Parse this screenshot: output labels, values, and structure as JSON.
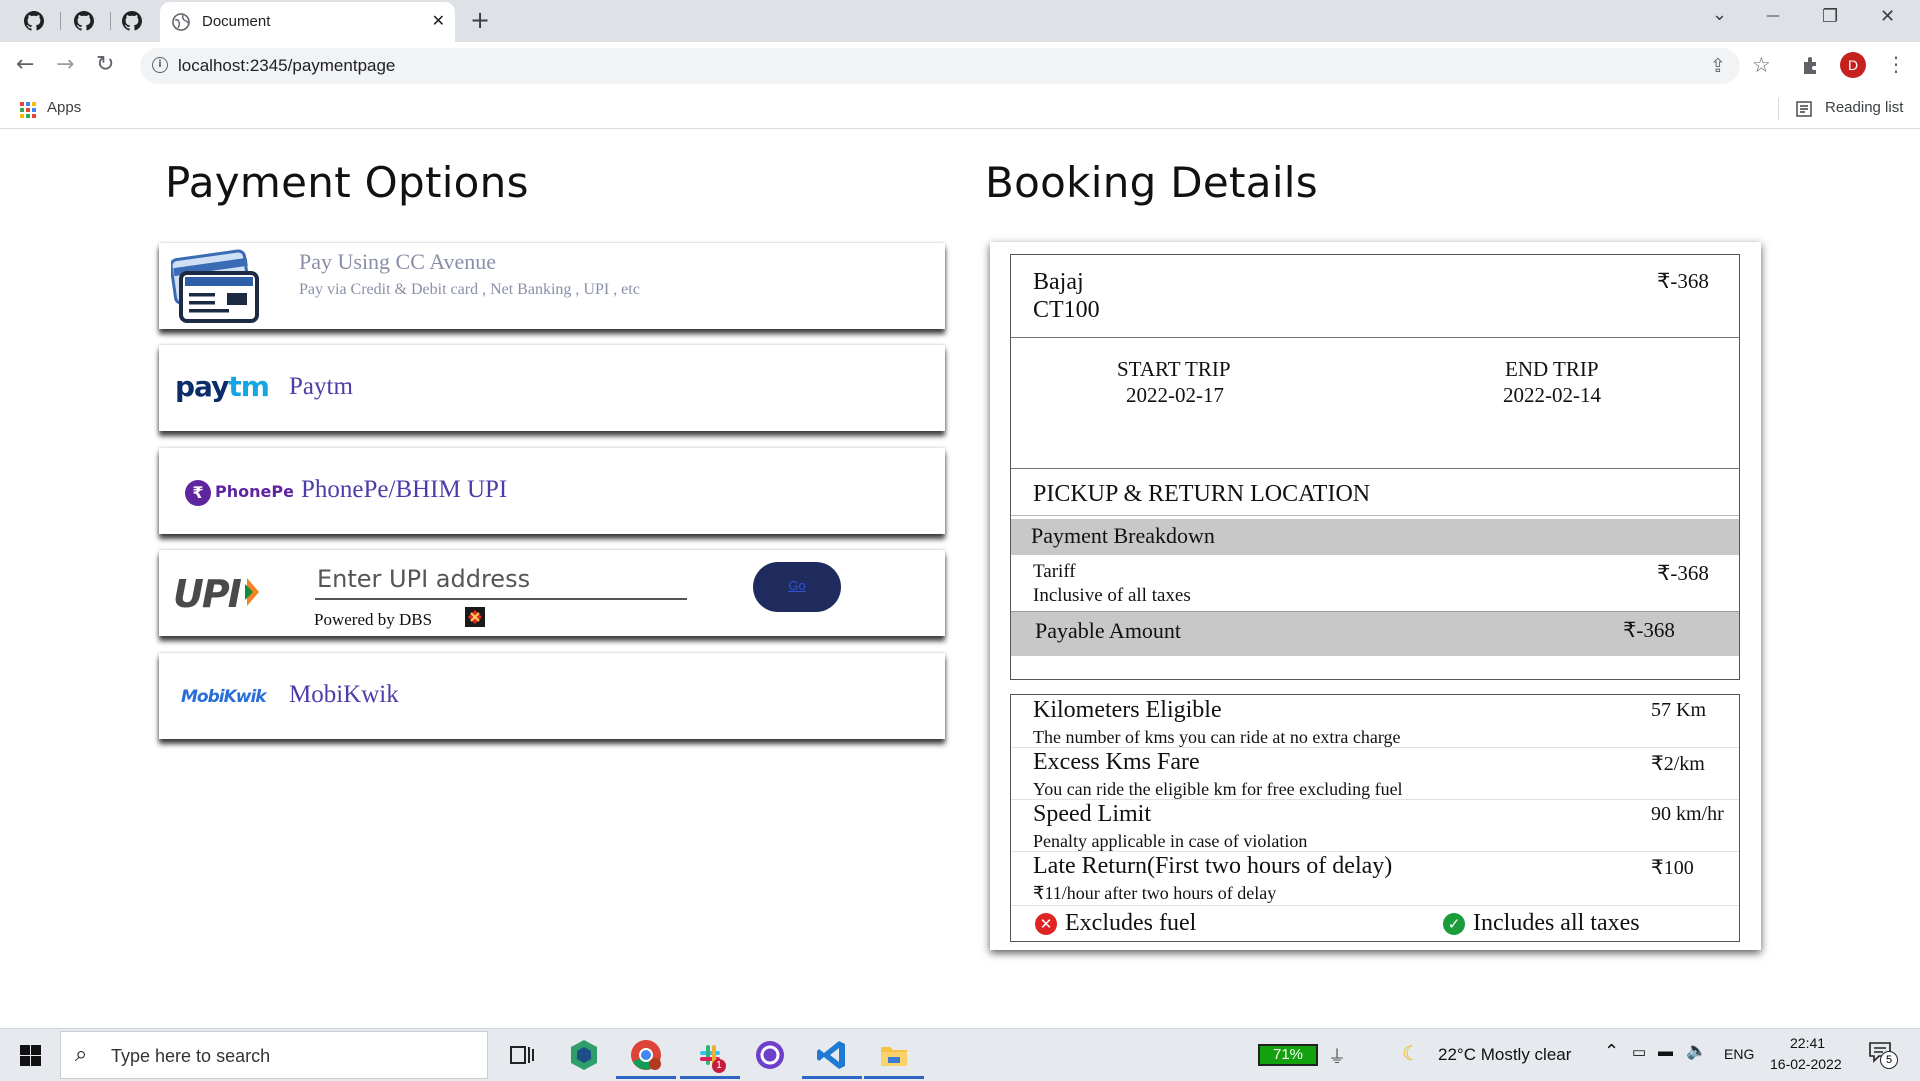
{
  "browser": {
    "tab_title": "Document",
    "tab_close": "✕",
    "new_tab": "+",
    "url": "localhost:2345/paymentpage",
    "avatar_letter": "D",
    "bookmarks_apps": "Apps",
    "reading_list": "Reading list",
    "window_controls": {
      "dropdown": "⌄",
      "minimize": "—",
      "restore": "❐",
      "close": "✕"
    }
  },
  "payment": {
    "heading": "Payment Options",
    "cc_avenue": {
      "title": "Pay Using CC Avenue",
      "subtitle": "Pay via Credit & Debit card , Net Banking , UPI , etc"
    },
    "paytm": {
      "logo_text": "paytm",
      "label": "Paytm"
    },
    "phonepe": {
      "logo_text": "PhonePe",
      "label": "PhonePe/BHIM UPI"
    },
    "upi": {
      "logo_text": "UPI",
      "placeholder": "Enter UPI address",
      "powered_by": "Powered by DBS",
      "go_label": "Go"
    },
    "mobikwik": {
      "logo_text": "MobiKwik",
      "label": "MobiKwik"
    }
  },
  "booking": {
    "heading": "Booking Details",
    "vehicle": {
      "brand": "Bajaj",
      "model": "CT100",
      "price": "₹-368"
    },
    "start_trip": {
      "label": "START TRIP",
      "date": "2022-02-17"
    },
    "end_trip": {
      "label": "END TRIP",
      "date": "2022-02-14"
    },
    "pickup_label": "PICKUP & RETURN LOCATION",
    "breakdown_label": "Payment Breakdown",
    "tariff": {
      "label": "Tariff",
      "note": "Inclusive of all taxes",
      "value": "₹-368"
    },
    "payable": {
      "label": "Payable Amount",
      "value": "₹-368"
    },
    "terms": [
      {
        "title": "Kilometers Eligible",
        "desc": "The number of kms you can ride at no extra charge",
        "value": "57 Km"
      },
      {
        "title": "Excess Kms Fare",
        "desc": "You can ride the eligible km for free excluding fuel",
        "value": "₹2/km"
      },
      {
        "title": "Speed Limit",
        "desc": "Penalty applicable in case of violation",
        "value": "90 km/hr"
      },
      {
        "title": "Late Return(First two hours of delay)",
        "desc": "₹11/hour after two hours of delay",
        "value": "₹100"
      }
    ],
    "excludes_fuel": "Excludes fuel",
    "includes_taxes": "Includes all taxes"
  },
  "taskbar": {
    "search_placeholder": "Type here to search",
    "battery": "71%",
    "weather": "22°C  Mostly clear",
    "language": "ENG",
    "time": "22:41",
    "date": "16-02-2022",
    "notification_count": "5",
    "slack_badge": "1"
  },
  "colors": {
    "accent_purple": "#4b3ea8",
    "go_button": "#1f2b5c",
    "payable_band": "#c8c8c8",
    "excludes_red": "#e02424",
    "includes_green": "#1a9c3a"
  }
}
